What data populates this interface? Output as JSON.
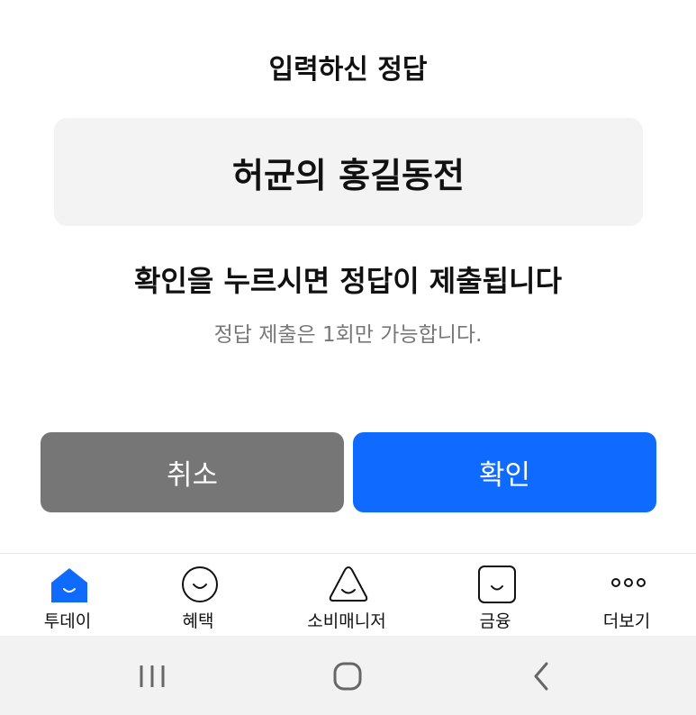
{
  "dialog": {
    "title": "입력하신 정답",
    "answer": "허균의 홍길동전",
    "confirm_message": "확인을 누르시면 정답이 제출됩니다",
    "note": "정답 제출은 1회만 가능합니다.",
    "cancel_label": "취소",
    "confirm_label": "확인"
  },
  "bottom_nav": {
    "items": [
      {
        "label": "투데이",
        "icon": "home-icon",
        "active": true
      },
      {
        "label": "혜택",
        "icon": "smile-circle-icon"
      },
      {
        "label": "소비매니저",
        "icon": "smile-triangle-icon"
      },
      {
        "label": "금융",
        "icon": "smile-square-icon"
      },
      {
        "label": "더보기",
        "icon": "more-dots-icon"
      }
    ]
  },
  "system_nav": {
    "recents": "recents-icon",
    "home": "home-button-icon",
    "back": "back-icon"
  },
  "colors": {
    "accent": "#0f6bff",
    "cancel": "#767676",
    "answer_bg": "#f3f3f3"
  }
}
